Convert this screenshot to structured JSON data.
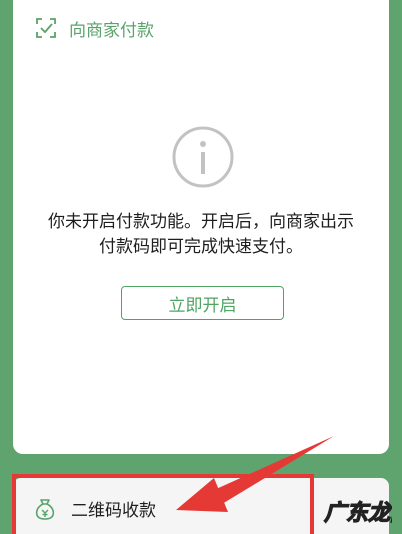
{
  "header": {
    "title": "向商家付款",
    "icon": "scan-icon"
  },
  "notice": {
    "icon": "info-icon",
    "line1": "你未开启付款功能。开启后，向商家出示",
    "line2": "付款码即可完成快速支付。"
  },
  "actions": {
    "open_label": "立即开启"
  },
  "bottom": {
    "collect_label": "二维码收款",
    "icon": "money-bag-icon"
  },
  "overlay": {
    "highlight_color": "#e53935",
    "arrow_color": "#e53935"
  },
  "colors": {
    "background": "#5fa36e",
    "accent": "#4fa463",
    "text": "#1e1e1e"
  }
}
